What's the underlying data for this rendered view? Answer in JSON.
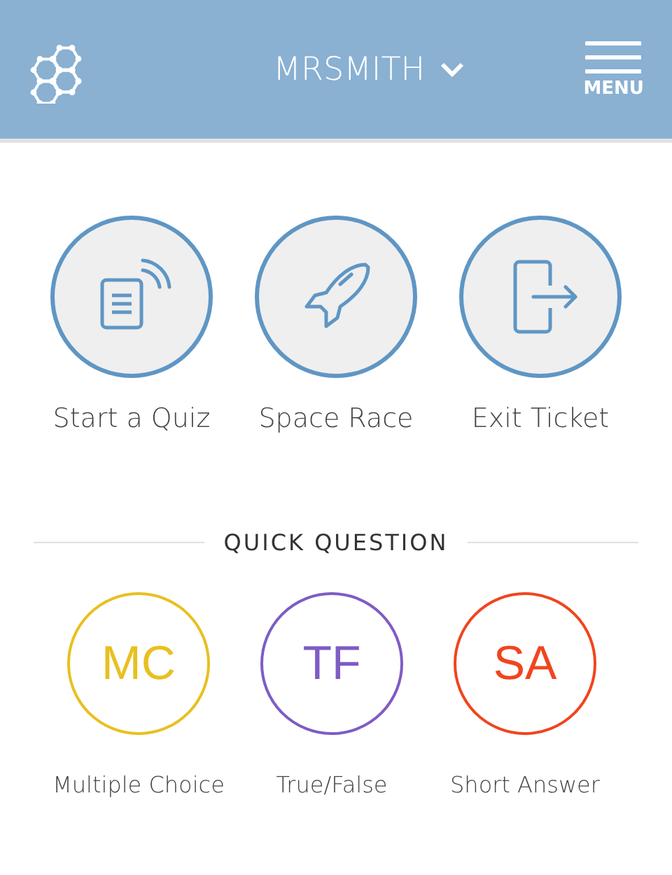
{
  "header": {
    "account": "MRSMITH",
    "menu_label": "MENU"
  },
  "activities": [
    {
      "kind": "quiz",
      "label": "Start a Quiz"
    },
    {
      "kind": "rocket",
      "label": "Space Race"
    },
    {
      "kind": "exit",
      "label": "Exit Ticket"
    }
  ],
  "quick_question": {
    "title": "QUICK QUESTION",
    "types": [
      {
        "abbr": "MC",
        "label": "Multiple Choice",
        "color": "#e8c020"
      },
      {
        "abbr": "TF",
        "label": "True/False",
        "color": "#7e5cc4"
      },
      {
        "abbr": "SA",
        "label": "Short Answer",
        "color": "#f0451e"
      }
    ]
  }
}
